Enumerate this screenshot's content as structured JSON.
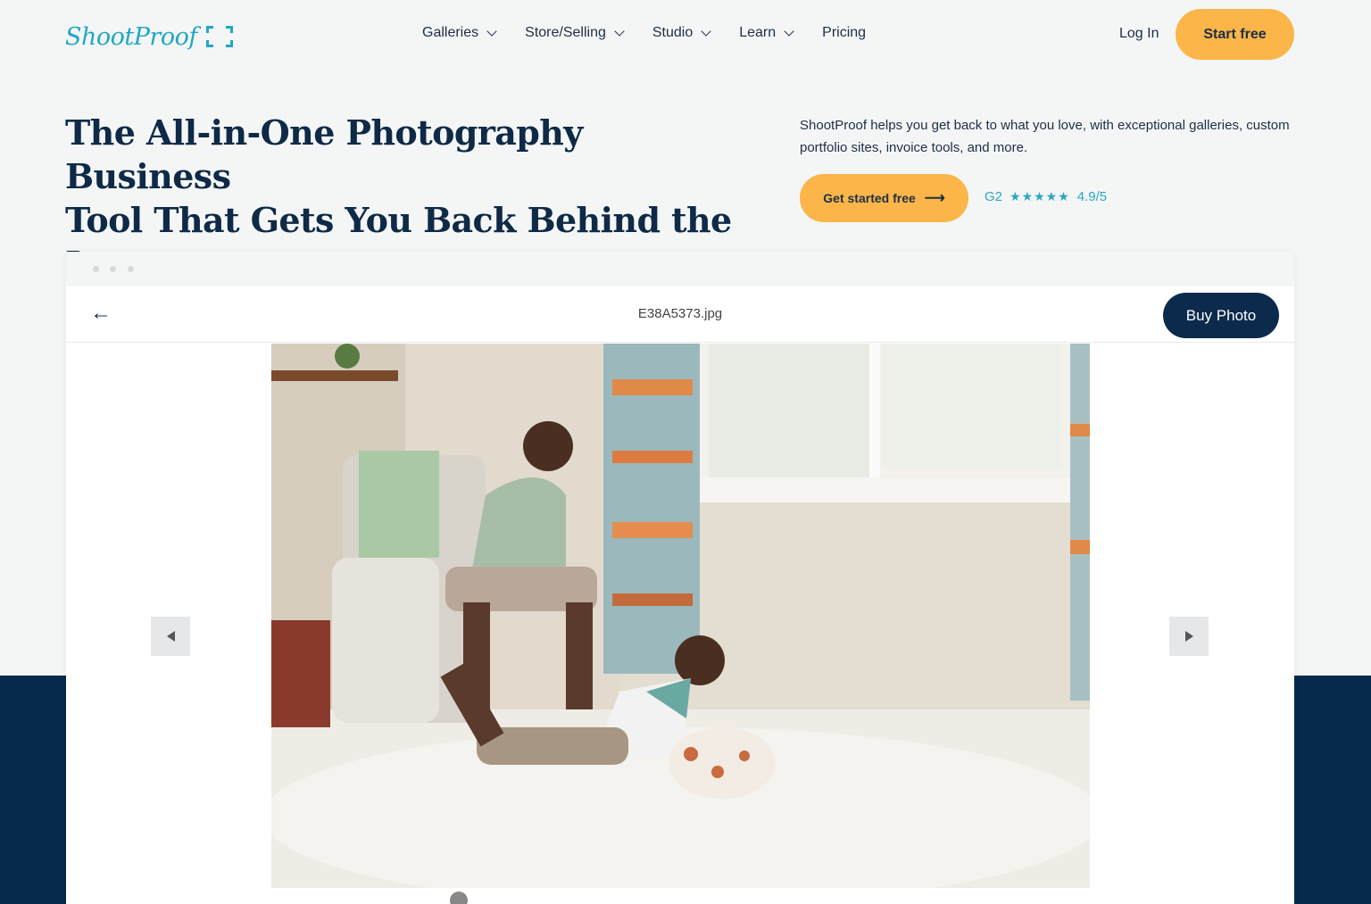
{
  "nav": {
    "logo_text": "ShootProof",
    "menu": [
      {
        "label": "Galleries",
        "has_dropdown": true
      },
      {
        "label": "Store/Selling",
        "has_dropdown": true
      },
      {
        "label": "Studio",
        "has_dropdown": true
      },
      {
        "label": "Learn",
        "has_dropdown": true
      },
      {
        "label": "Pricing",
        "has_dropdown": false
      }
    ],
    "login_label": "Log In",
    "start_free_label": "Start free"
  },
  "hero": {
    "headline_line1": "The All-in-One Photography Business",
    "headline_line2": "Tool That Gets You Back Behind the Lens",
    "subtext": "ShootProof helps you get back to what you love, with exceptional galleries, custom portfolio sites, invoice tools, and more.",
    "cta_label": "Get started free",
    "rating_source": "G2",
    "stars": "★★★★★",
    "rating_value": "4.9/5"
  },
  "viewer": {
    "filename": "E38A5373.jpg",
    "buy_label": "Buy Photo"
  },
  "colors": {
    "accent": "#fbb549",
    "navy": "#062a4b",
    "teal": "#21a7c4"
  }
}
